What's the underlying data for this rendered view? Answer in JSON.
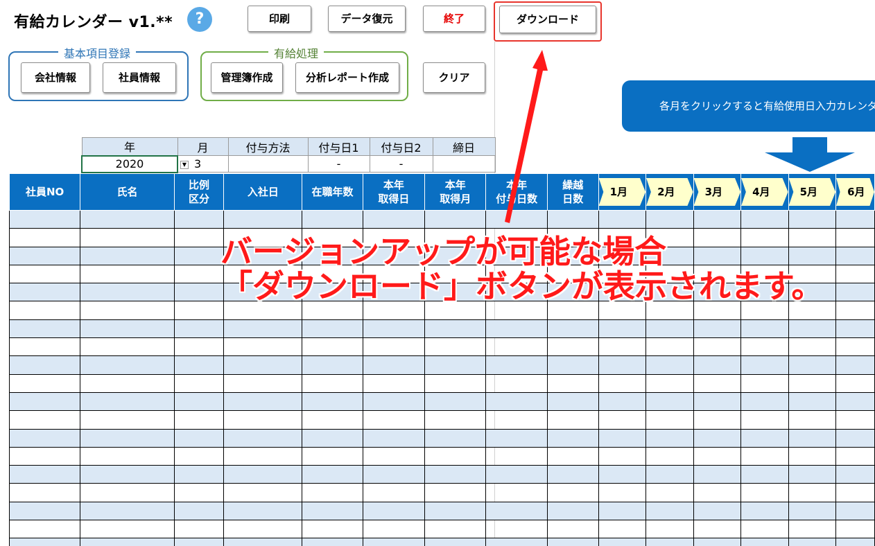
{
  "app": {
    "title": "有給カレンダー v1.**"
  },
  "help": {
    "icon": "?"
  },
  "toolbar": {
    "print": "印刷",
    "restore": "データ復元",
    "exit": "終了",
    "download": "ダウンロード",
    "clear": "クリア"
  },
  "group_basic": {
    "title": "基本項目登録",
    "company": "会社情報",
    "employee": "社員情報"
  },
  "group_paid": {
    "title": "有給処理",
    "ledger": "管理簿作成",
    "report": "分析レポート作成"
  },
  "callout": {
    "text": "各月をクリックすると有給使用日入力カレンダーを表示"
  },
  "params": {
    "headers": [
      "年",
      "月",
      "付与方法",
      "付与日1",
      "付与日2",
      "締日"
    ],
    "values": [
      "2020",
      "3",
      "",
      "-",
      "-",
      ""
    ]
  },
  "grid": {
    "headers": [
      "社員NO",
      "氏名",
      "比例\n区分",
      "入社日",
      "在職年数",
      "本年\n取得日",
      "本年\n取得月",
      "本年\n付与日数",
      "繰越\n日数"
    ],
    "months": [
      "1月",
      "2月",
      "3月",
      "4月",
      "5月",
      "6月"
    ]
  },
  "annotation": {
    "line1": "バージョンアップが可能な場合",
    "line2": "「ダウンロード」ボタンが表示されます。"
  },
  "colors": {
    "header": "#0a6fc2",
    "shade": "#dbe8f5",
    "month_chip": "#ffffcc",
    "annotation": "#ff1a1a",
    "green": "#217346"
  }
}
